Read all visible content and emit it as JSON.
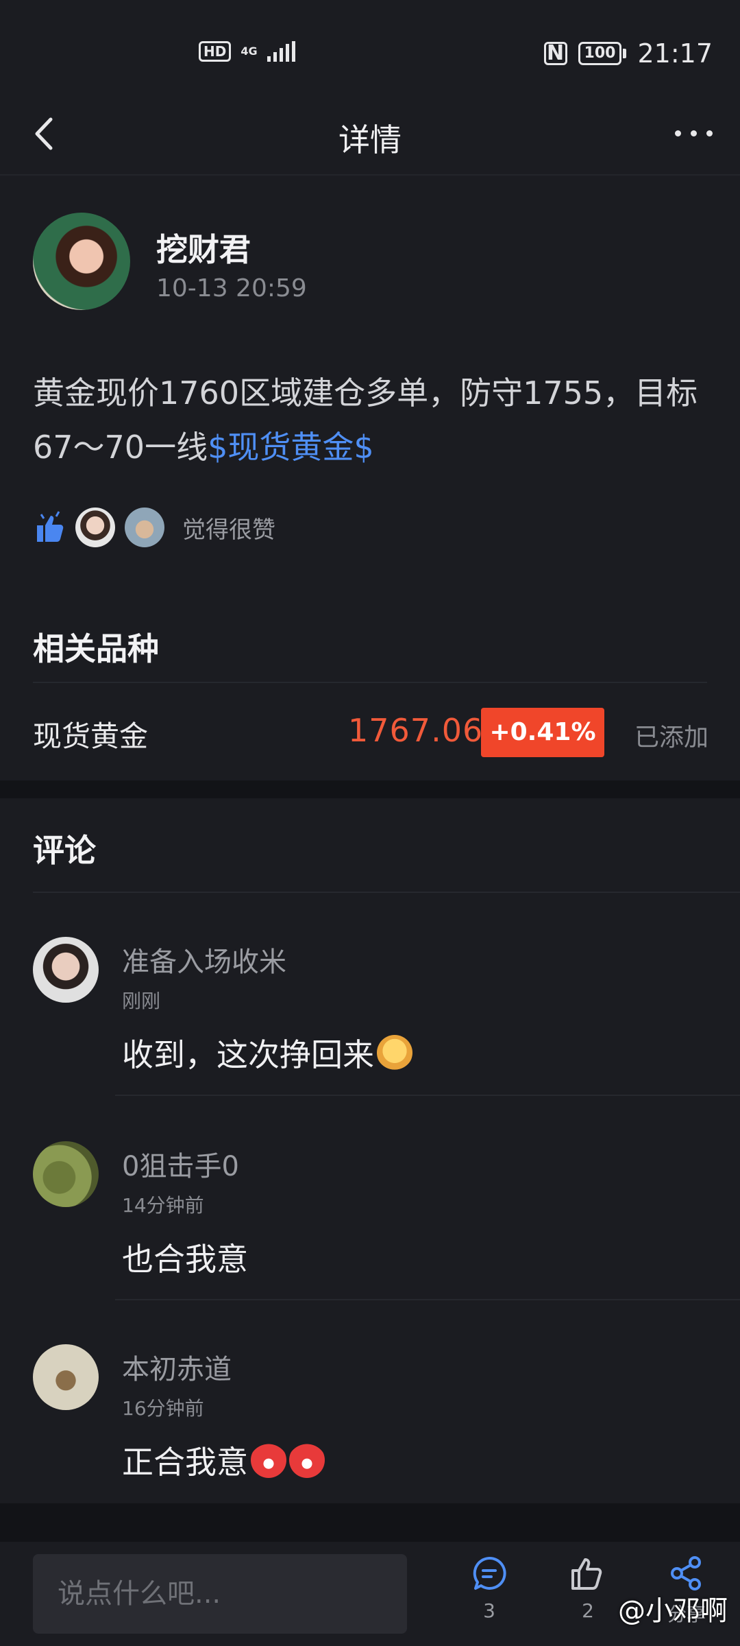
{
  "status_bar": {
    "hd": "HD",
    "network": "4G",
    "nfc": "N",
    "battery": "100",
    "time": "21:17"
  },
  "header": {
    "title": "详情"
  },
  "post": {
    "author": "挖财君",
    "time": "10-13 20:59",
    "text": "黄金现价1760区域建仓多单，防守1755，目标67～70一线",
    "link_text": "$现货黄金$",
    "likes_text": "觉得很赞"
  },
  "related": {
    "title": "相关品种",
    "item": {
      "name": "现货黄金",
      "price": "1767.06",
      "change": "+0.41%",
      "status": "已添加"
    },
    "colors": {
      "up": "#f0462a"
    }
  },
  "comments": {
    "title": "评论",
    "items": [
      {
        "name": "准备入场收米",
        "time": "刚刚",
        "text": "收到，这次挣回来"
      },
      {
        "name": "0狙击手0",
        "time": "14分钟前",
        "text": "也合我意"
      },
      {
        "name": "本初赤道",
        "time": "16分钟前",
        "text": "正合我意"
      }
    ]
  },
  "bottom_bar": {
    "placeholder": "说点什么吧...",
    "comment_count": "3",
    "like_count": "2",
    "share_label": "分享"
  },
  "watermark": "@小邓啊"
}
